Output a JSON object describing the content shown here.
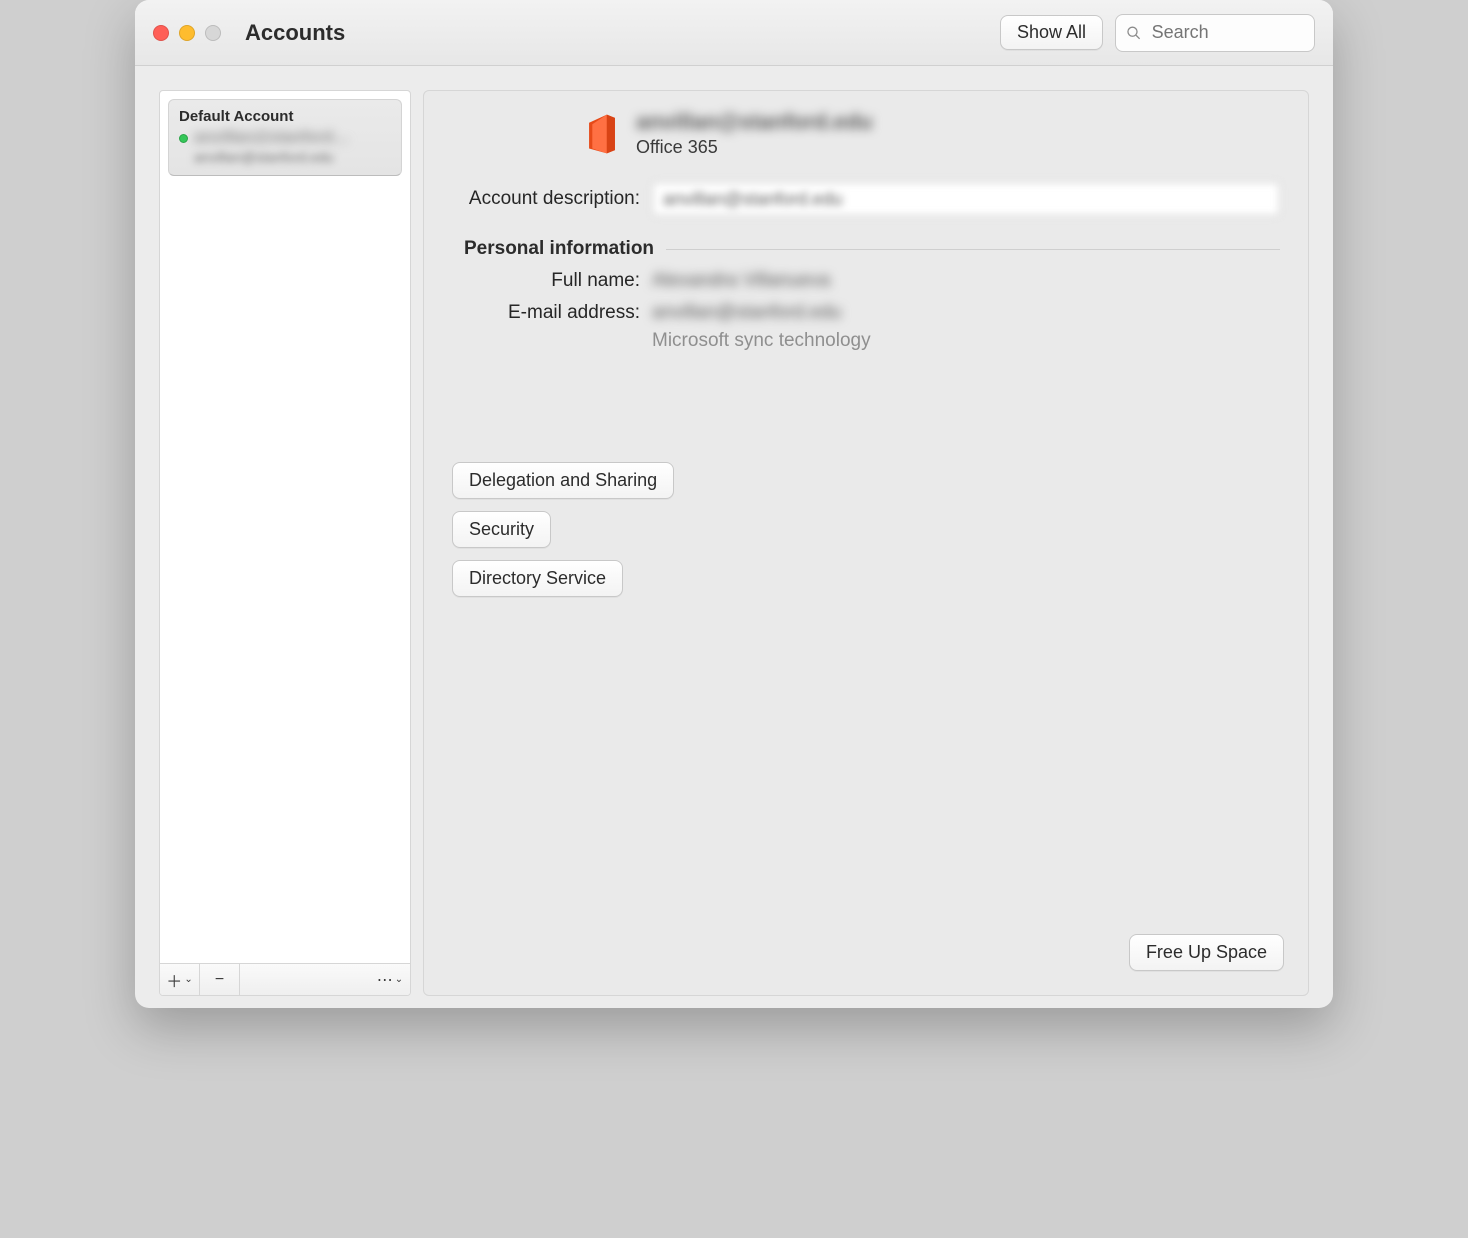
{
  "window": {
    "title": "Accounts"
  },
  "toolbar": {
    "show_all": "Show All",
    "search_placeholder": "Search"
  },
  "sidebar": {
    "default_account_label": "Default Account",
    "account_primary_blurred": "anvillan@stanford…",
    "account_secondary_blurred": "anvillan@stanford.edu"
  },
  "header": {
    "email_blurred": "anvillan@stanford.edu",
    "service_name": "Office 365"
  },
  "fields": {
    "account_description_label": "Account description:",
    "account_description_value_blurred": "anvillan@stanford.edu",
    "personal_info_section": "Personal information",
    "full_name_label": "Full name:",
    "full_name_value_blurred": "Alexandra Villanueva",
    "email_label": "E-mail address:",
    "email_value_blurred": "anvillan@stanford.edu",
    "sync_note": "Microsoft sync technology"
  },
  "buttons": {
    "delegation": "Delegation and Sharing",
    "security": "Security",
    "directory": "Directory Service",
    "free_up_space": "Free Up Space"
  },
  "icons": {
    "add": "＋",
    "remove": "−",
    "more": "⋯"
  }
}
